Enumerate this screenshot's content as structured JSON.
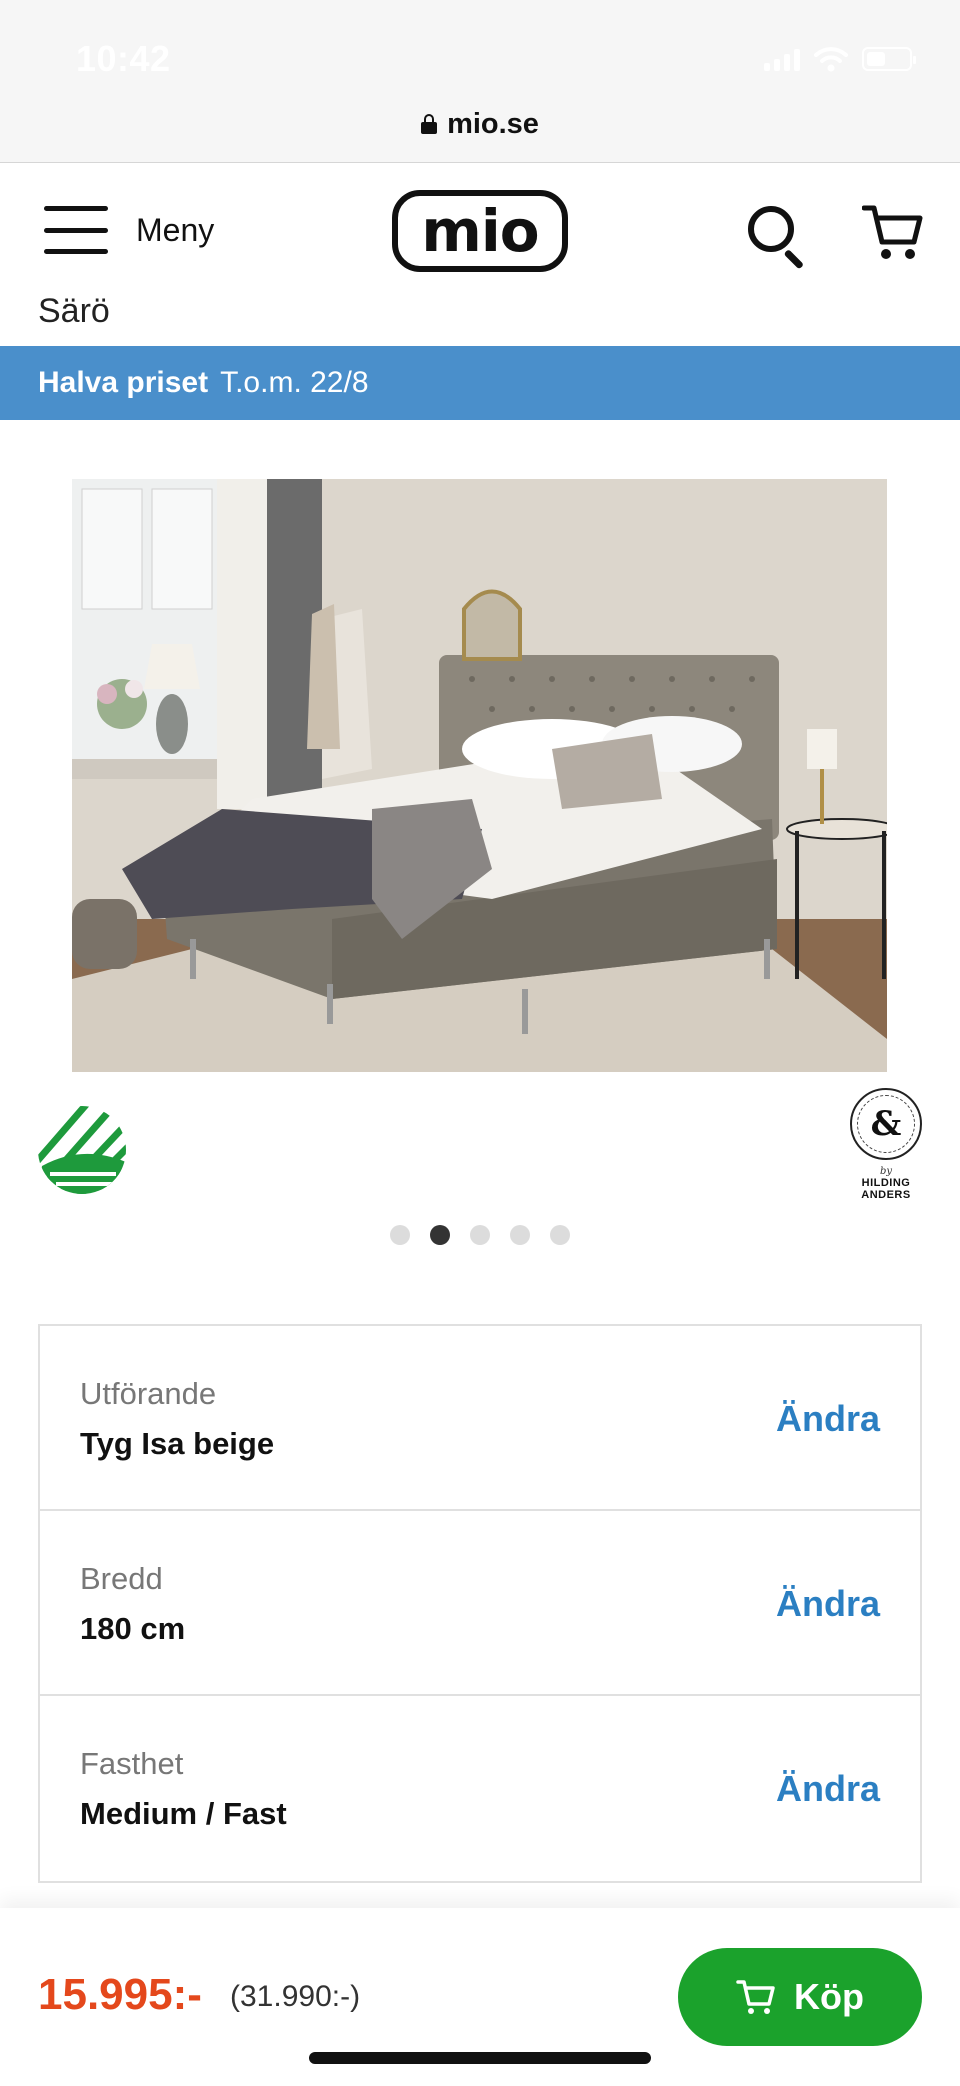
{
  "status_bar": {
    "time": "10:42"
  },
  "browser": {
    "url": "mio.se"
  },
  "header": {
    "menu_label": "Meny",
    "logo_text": "mio"
  },
  "breadcrumb": "Särö",
  "promo": {
    "title": "Halva priset",
    "subtitle": "T.o.m. 22/8"
  },
  "gallery": {
    "active_index": 1,
    "count": 5
  },
  "badges": {
    "brand_by": "by",
    "brand_name_line1": "HILDING",
    "brand_name_line2": "ANDERS"
  },
  "options": [
    {
      "label": "Utförande",
      "value": "Tyg Isa beige",
      "action": "Ändra"
    },
    {
      "label": "Bredd",
      "value": "180 cm",
      "action": "Ändra"
    },
    {
      "label": "Fasthet",
      "value": "Medium / Fast",
      "action": "Ändra"
    }
  ],
  "purchase": {
    "price": "15.995:-",
    "original_price": "(31.990:-)",
    "buy_label": "Köp"
  },
  "colors": {
    "promo_bg": "#4a8fcb",
    "link_blue": "#2b7fc2",
    "price_orange": "#e4481c",
    "buy_green": "#1ba22c"
  }
}
